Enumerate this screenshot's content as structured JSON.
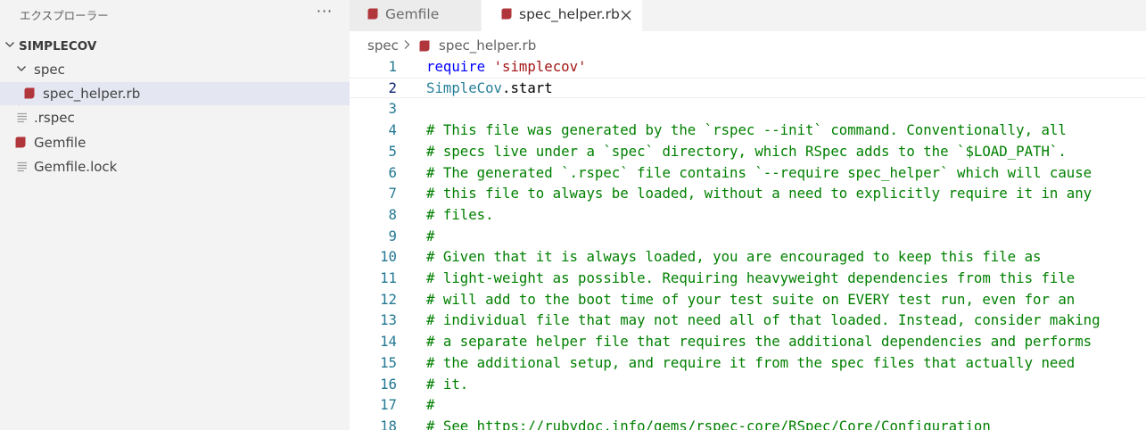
{
  "sidebar": {
    "title": "エクスプローラー",
    "more_glyph": "···",
    "root_folder": "SIMPLECOV",
    "items": [
      {
        "label": "spec",
        "type": "folder",
        "icon": "chevron-down-icon"
      },
      {
        "label": "spec_helper.rb",
        "type": "file",
        "icon": "ruby-icon",
        "selected": true
      },
      {
        "label": ".rspec",
        "type": "file",
        "icon": "lines-file-icon"
      },
      {
        "label": "Gemfile",
        "type": "file",
        "icon": "ruby-icon"
      },
      {
        "label": "Gemfile.lock",
        "type": "file",
        "icon": "lines-file-icon"
      }
    ]
  },
  "tabs": [
    {
      "label": "Gemfile",
      "active": false
    },
    {
      "label": "spec_helper.rb",
      "active": true
    }
  ],
  "breadcrumb": {
    "folder": "spec",
    "file": "spec_helper.rb"
  },
  "editor": {
    "current_line": 2,
    "lines": [
      {
        "n": "1",
        "tokens": [
          {
            "t": "require",
            "c": "kw"
          },
          {
            "t": " ",
            "c": "plain"
          },
          {
            "t": "'simplecov'",
            "c": "str"
          }
        ]
      },
      {
        "n": "2",
        "tokens": [
          {
            "t": "SimpleCov",
            "c": "cls"
          },
          {
            "t": ".start",
            "c": "plain"
          }
        ]
      },
      {
        "n": "3",
        "tokens": []
      },
      {
        "n": "4",
        "tokens": [
          {
            "t": "# This file was generated by the `rspec --init` command. Conventionally, all",
            "c": "cmt"
          }
        ]
      },
      {
        "n": "5",
        "tokens": [
          {
            "t": "# specs live under a `spec` directory, which RSpec adds to the `$LOAD_PATH`.",
            "c": "cmt"
          }
        ]
      },
      {
        "n": "6",
        "tokens": [
          {
            "t": "# The generated `.rspec` file contains `--require spec_helper` which will cause",
            "c": "cmt"
          }
        ]
      },
      {
        "n": "7",
        "tokens": [
          {
            "t": "# this file to always be loaded, without a need to explicitly require it in any",
            "c": "cmt"
          }
        ]
      },
      {
        "n": "8",
        "tokens": [
          {
            "t": "# files.",
            "c": "cmt"
          }
        ]
      },
      {
        "n": "9",
        "tokens": [
          {
            "t": "#",
            "c": "cmt"
          }
        ]
      },
      {
        "n": "10",
        "tokens": [
          {
            "t": "# Given that it is always loaded, you are encouraged to keep this file as",
            "c": "cmt"
          }
        ]
      },
      {
        "n": "11",
        "tokens": [
          {
            "t": "# light-weight as possible. Requiring heavyweight dependencies from this file",
            "c": "cmt"
          }
        ]
      },
      {
        "n": "12",
        "tokens": [
          {
            "t": "# will add to the boot time of your test suite on EVERY test run, even for an",
            "c": "cmt"
          }
        ]
      },
      {
        "n": "13",
        "tokens": [
          {
            "t": "# individual file that may not need all of that loaded. Instead, consider making",
            "c": "cmt"
          }
        ]
      },
      {
        "n": "14",
        "tokens": [
          {
            "t": "# a separate helper file that requires the additional dependencies and performs",
            "c": "cmt"
          }
        ]
      },
      {
        "n": "15",
        "tokens": [
          {
            "t": "# the additional setup, and require it from the spec files that actually need",
            "c": "cmt"
          }
        ]
      },
      {
        "n": "16",
        "tokens": [
          {
            "t": "# it.",
            "c": "cmt"
          }
        ]
      },
      {
        "n": "17",
        "tokens": [
          {
            "t": "#",
            "c": "cmt"
          }
        ]
      },
      {
        "n": "18",
        "tokens": [
          {
            "t": "# See https://rubydoc.info/gems/rspec-core/RSpec/Core/Configuration",
            "c": "cmt"
          }
        ]
      }
    ]
  },
  "colors": {
    "ruby_icon": "#b0363b",
    "line_number": "#237893",
    "comment": "#008000",
    "keyword": "#0000ff",
    "string": "#a31515",
    "class": "#267f99"
  }
}
